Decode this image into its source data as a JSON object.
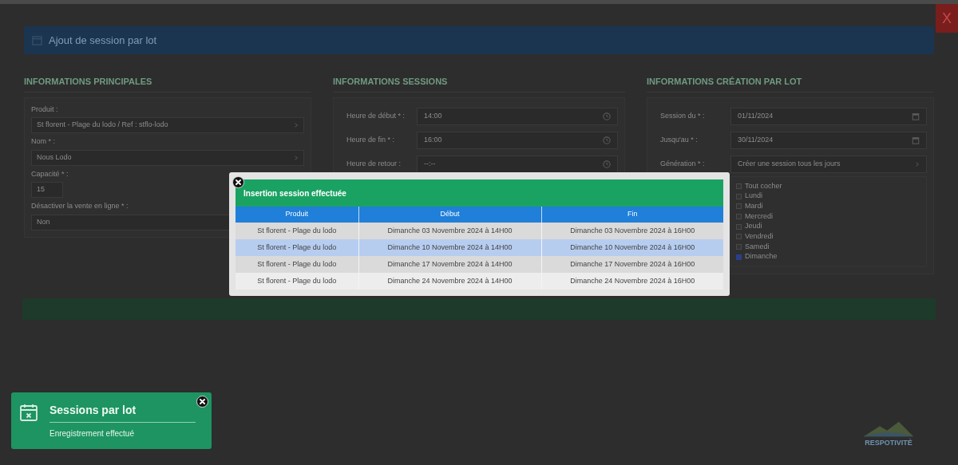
{
  "page_header": {
    "title": "Ajout de session par lot"
  },
  "close_button": {
    "label": "X"
  },
  "sections": [
    {
      "title": "INFORMATIONS PRINCIPALES",
      "fields": [
        {
          "kind": "select",
          "label": "Produit :",
          "value": "St florent - Plage du lodo / Ref : stflo-lodo"
        },
        {
          "kind": "select",
          "label": "Nom * :",
          "value": "Nous Lodo"
        },
        {
          "kind": "text",
          "label": "Capacité * :",
          "value": "15"
        },
        {
          "kind": "select",
          "label": "Désactiver la vente en ligne * :",
          "value": "Non"
        }
      ]
    },
    {
      "title": "INFORMATIONS SESSIONS",
      "fields": [
        {
          "kind": "time",
          "label": "Heure de début * :",
          "value": "14:00"
        },
        {
          "kind": "time",
          "label": "Heure de fin * :",
          "value": "16:00"
        },
        {
          "kind": "time",
          "label": "Heure de retour :",
          "value": "--:--"
        }
      ]
    },
    {
      "title": "INFORMATIONS CRÉATION PAR LOT",
      "fields": [
        {
          "kind": "date",
          "label": "Session du * :",
          "value": "01/11/2024"
        },
        {
          "kind": "date",
          "label": "Jusqu'au * :",
          "value": "30/11/2024"
        },
        {
          "kind": "select",
          "label": "Génération * :",
          "value": "Créer une session tous les jours"
        }
      ],
      "days": [
        {
          "label": "Tout cocher",
          "checked": false
        },
        {
          "label": "Lundi",
          "checked": false
        },
        {
          "label": "Mardi",
          "checked": false
        },
        {
          "label": "Mercredi",
          "checked": false
        },
        {
          "label": "Jeudi",
          "checked": false
        },
        {
          "label": "Vendredi",
          "checked": false
        },
        {
          "label": "Samedi",
          "checked": false
        },
        {
          "label": "Dimanche",
          "checked": true
        }
      ]
    }
  ],
  "modal": {
    "title": "Insertion session effectuée",
    "columns": [
      "Produit",
      "Début",
      "Fin"
    ],
    "rows": [
      {
        "cells": [
          "St florent - Plage du lodo",
          "Dimanche 03 Novembre 2024 à 14H00",
          "Dimanche 03 Novembre 2024 à 16H00"
        ],
        "highlighted": false
      },
      {
        "cells": [
          "St florent - Plage du lodo",
          "Dimanche 10 Novembre 2024 à 14H00",
          "Dimanche 10 Novembre 2024 à 16H00"
        ],
        "highlighted": true
      },
      {
        "cells": [
          "St florent - Plage du lodo",
          "Dimanche 17 Novembre 2024 à 14H00",
          "Dimanche 17 Novembre 2024 à 16H00"
        ],
        "highlighted": false
      },
      {
        "cells": [
          "St florent - Plage du lodo",
          "Dimanche 24 Novembre 2024 à 14H00",
          "Dimanche 24 Novembre 2024 à 16H00"
        ],
        "highlighted": false
      }
    ]
  },
  "toast": {
    "title": "Sessions par lot",
    "message": "Enregistrement effectué"
  },
  "logo": {
    "text": "RESPOTIVITÉ"
  }
}
